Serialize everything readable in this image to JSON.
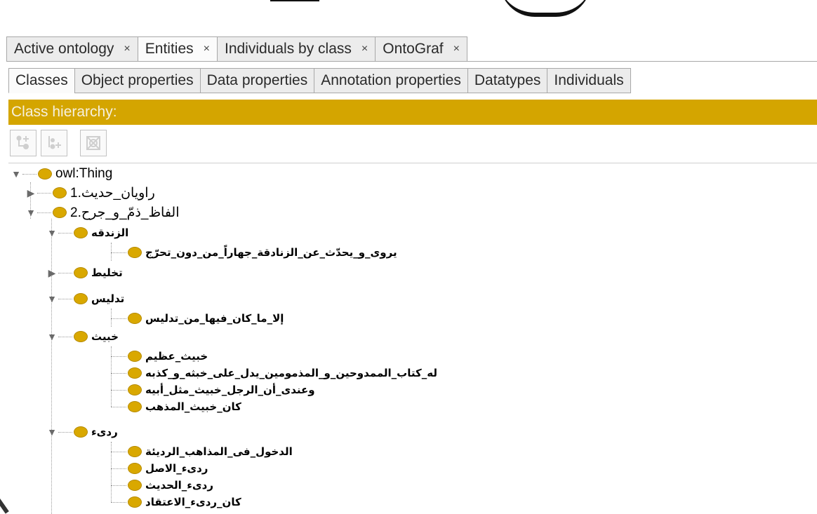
{
  "tabs": [
    {
      "label": "Active ontology",
      "close": "×",
      "active": false
    },
    {
      "label": "Entities",
      "close": "×",
      "active": true
    },
    {
      "label": "Individuals by class",
      "close": "×",
      "active": false
    },
    {
      "label": "OntoGraf",
      "close": "×",
      "active": false
    }
  ],
  "subtabs": [
    {
      "label": "Classes",
      "active": true
    },
    {
      "label": "Object properties",
      "active": false
    },
    {
      "label": "Data properties",
      "active": false
    },
    {
      "label": "Annotation properties",
      "active": false
    },
    {
      "label": "Datatypes",
      "active": false
    },
    {
      "label": "Individuals",
      "active": false
    }
  ],
  "hierarchy": {
    "title": "Class hierarchy:",
    "header_color": "#d4a500",
    "node_color": "#d9a800",
    "toolbar_icons": [
      "add-subclass-icon",
      "add-sibling-class-icon",
      "delete-class-icon"
    ]
  },
  "tree": {
    "root": "owl:Thing",
    "n1": "1.راویان_حدیث",
    "n2": "2.الفاظ_ذمّ_و_جرح",
    "n2_1": "الزندقه",
    "n2_1_1": "یروی_و_یحدّث_عن_الزنادقة_جهاراً_من_دون_تحرّج",
    "n2_2": "تخلیط",
    "n2_3": "تدلیس",
    "n2_3_1": "إلا_ما_کان_فیها_من_تدلیس",
    "n2_4": "خبیث",
    "n2_4_1": "خبیث_عظیم",
    "n2_4_2": "له_کتاب_الممدوحین_و_المذمومین_یدل_علی_خبثه_و_کذبه",
    "n2_4_3": "وعندی_أن_الرجل_خبیث_مثل_أبیه",
    "n2_4_4": "کان_خبیث_المذهب",
    "n2_5": "ردیء",
    "n2_5_1": "الدخول_فی_المذاهب_الردیئة",
    "n2_5_2": "ردیء_الاصل",
    "n2_5_3": "ردیء_الحدیث",
    "n2_5_4": "کان_ردیء_الاعتقاد"
  }
}
